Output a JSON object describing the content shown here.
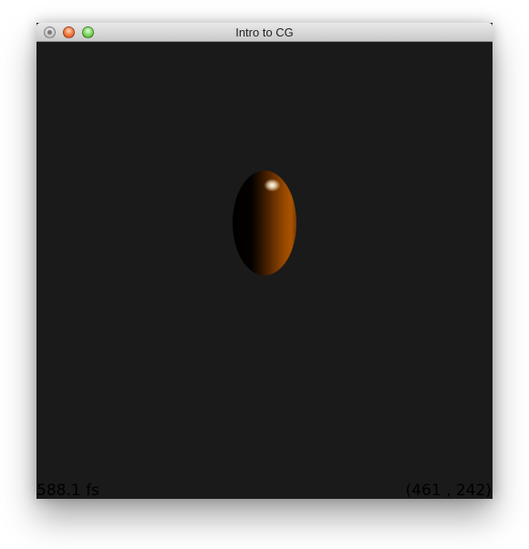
{
  "window": {
    "title": "Intro to CG"
  },
  "titlebar": {
    "buttons": [
      {
        "name": "disabled-button",
        "color": "#b0b0b0"
      },
      {
        "name": "close-button",
        "color": "#f0743a"
      },
      {
        "name": "zoom-button",
        "color": "#7ad45b"
      }
    ]
  },
  "viewport": {
    "background": "#1a1a1a",
    "object": "shaded-ellipsoid",
    "object_color": "#9a4a00",
    "fps_text": "588.1 fs",
    "mouse_coords": "(461 , 242)"
  }
}
